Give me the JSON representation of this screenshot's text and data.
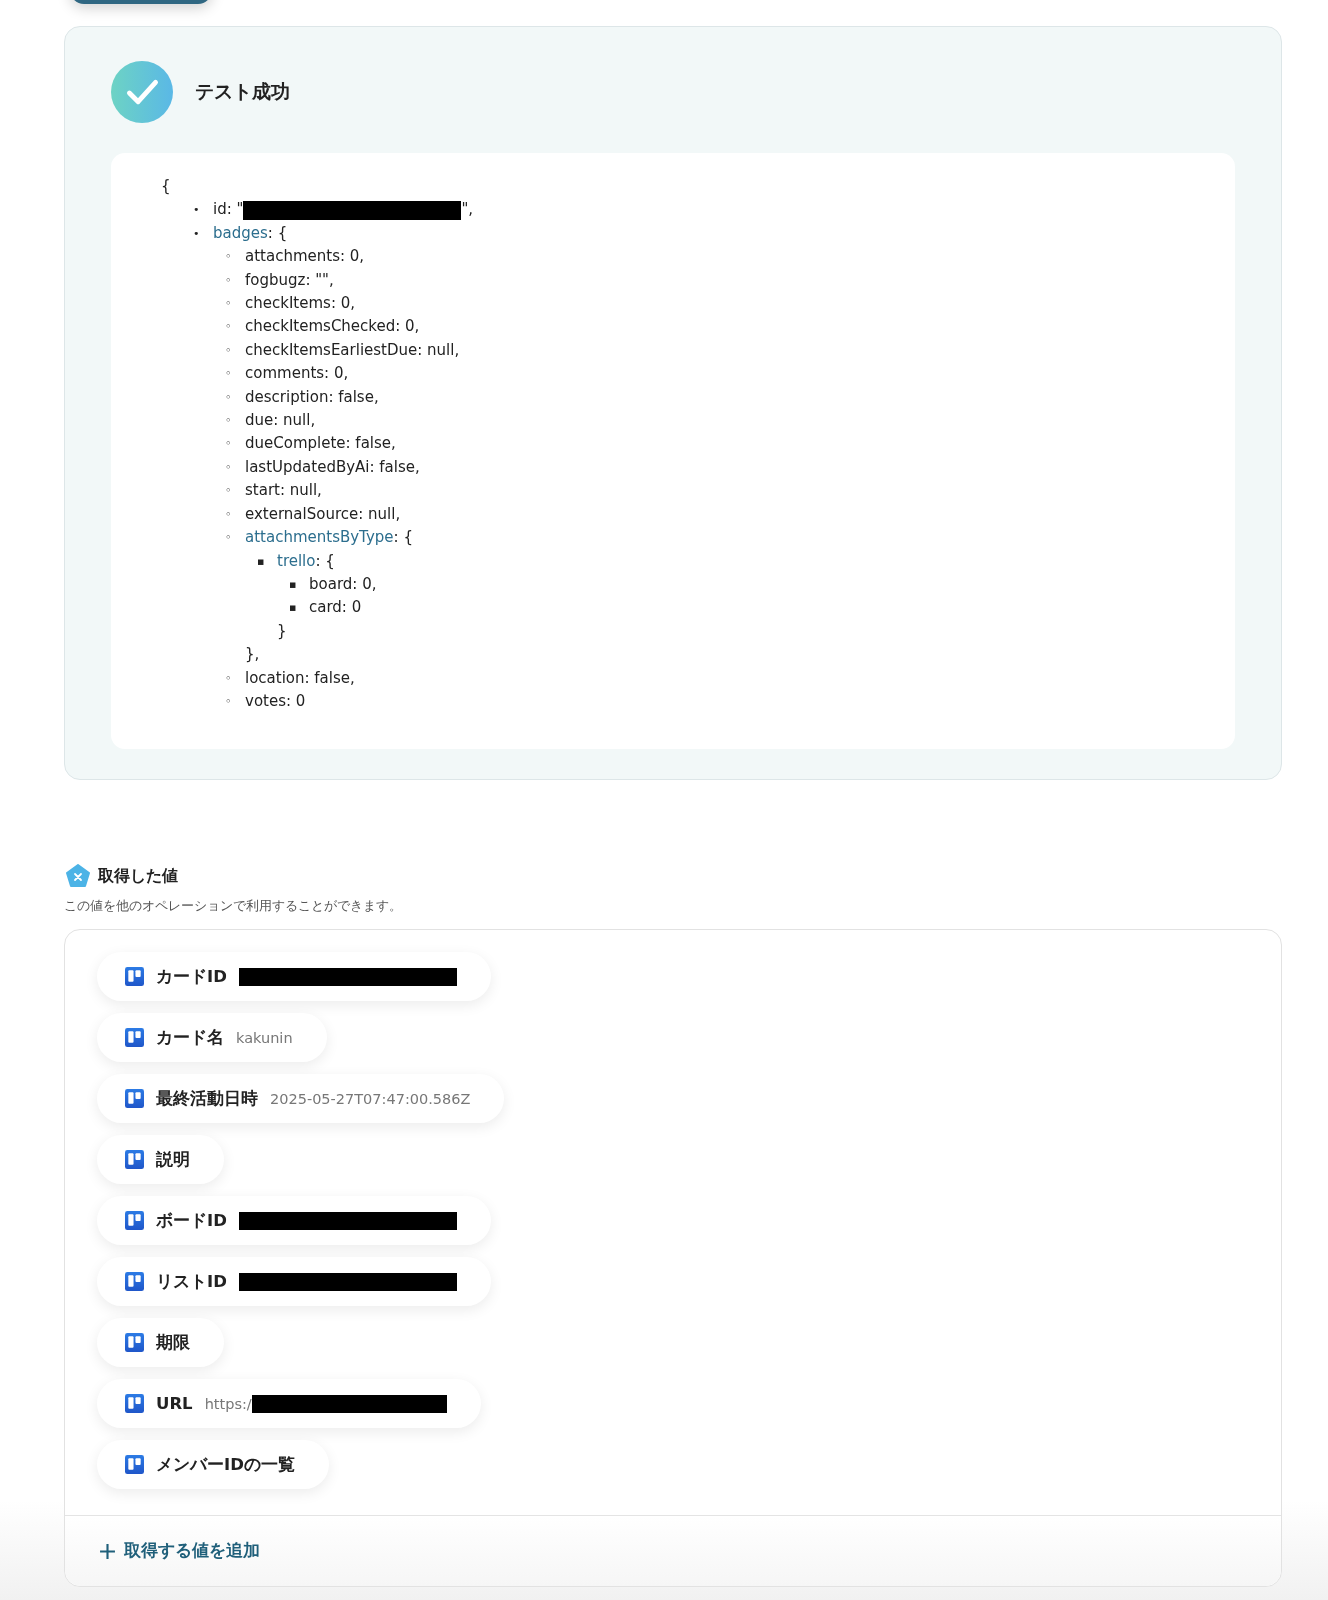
{
  "test_result": {
    "title": "テスト成功",
    "open_brace": "{",
    "tree": [
      {
        "marker": "•",
        "text": "id: \"",
        "redacted": true,
        "after": "\","
      },
      {
        "marker": "•",
        "key": "badges",
        "text": ": {",
        "children": [
          {
            "marker": "◦",
            "text": "attachments: 0,"
          },
          {
            "marker": "◦",
            "text": "fogbugz: \"\","
          },
          {
            "marker": "◦",
            "text": "checkItems: 0,"
          },
          {
            "marker": "◦",
            "text": "checkItemsChecked: 0,"
          },
          {
            "marker": "◦",
            "text": "checkItemsEarliestDue: null,"
          },
          {
            "marker": "◦",
            "text": "comments: 0,"
          },
          {
            "marker": "◦",
            "text": "description: false,"
          },
          {
            "marker": "◦",
            "text": "due: null,"
          },
          {
            "marker": "◦",
            "text": "dueComplete: false,"
          },
          {
            "marker": "◦",
            "text": "lastUpdatedByAi: false,"
          },
          {
            "marker": "◦",
            "text": "start: null,"
          },
          {
            "marker": "◦",
            "text": "externalSource: null,"
          },
          {
            "marker": "◦",
            "key": "attachmentsByType",
            "text": ": {",
            "close": "},",
            "children": [
              {
                "marker": "▪",
                "key": "trello",
                "text": ": {",
                "close": "}",
                "children": [
                  {
                    "marker": "▪",
                    "text": "board: 0,"
                  },
                  {
                    "marker": "▪",
                    "text": "card: 0"
                  }
                ]
              }
            ]
          },
          {
            "marker": "◦",
            "text": "location: false,"
          },
          {
            "marker": "◦",
            "text": "votes: 0"
          }
        ]
      }
    ]
  },
  "values": {
    "title": "取得した値",
    "description": "この値を他のオペレーションで利用することができます。",
    "items": [
      {
        "label": "カードID",
        "redacted": true
      },
      {
        "label": "カード名",
        "value": "kakunin"
      },
      {
        "label": "最終活動日時",
        "value": "2025-05-27T07:47:00.586Z"
      },
      {
        "label": "説明"
      },
      {
        "label": "ボードID",
        "redacted": true
      },
      {
        "label": "リストID",
        "redacted": true
      },
      {
        "label": "期限"
      },
      {
        "label": "URL",
        "value": "https:/",
        "redacted": true
      },
      {
        "label": "メンバーIDの一覧"
      }
    ],
    "add_button": "取得する値を追加"
  }
}
